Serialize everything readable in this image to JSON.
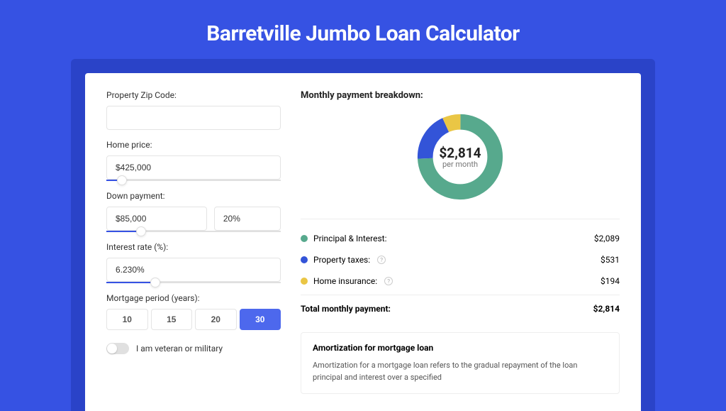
{
  "title": "Barretville Jumbo Loan Calculator",
  "form": {
    "zip": {
      "label": "Property Zip Code:",
      "value": ""
    },
    "home_price": {
      "label": "Home price:",
      "value": "$425,000",
      "slider_pct": 9
    },
    "down_payment": {
      "label": "Down payment:",
      "value": "$85,000",
      "pct_value": "20%",
      "slider_pct": 20
    },
    "interest": {
      "label": "Interest rate (%):",
      "value": "6.230%",
      "slider_pct": 28
    },
    "period": {
      "label": "Mortgage period (years):",
      "options": [
        "10",
        "15",
        "20",
        "30"
      ],
      "active": "30"
    },
    "veteran": {
      "label": "I am veteran or military",
      "on": false
    }
  },
  "breakdown": {
    "title": "Monthly payment breakdown:",
    "center_value": "$2,814",
    "center_sub": "per month",
    "rows": [
      {
        "label": "Principal & Interest:",
        "value": "$2,089",
        "color": "green",
        "info": false
      },
      {
        "label": "Property taxes:",
        "value": "$531",
        "color": "blue",
        "info": true
      },
      {
        "label": "Home insurance:",
        "value": "$194",
        "color": "yellow",
        "info": true
      }
    ],
    "total": {
      "label": "Total monthly payment:",
      "value": "$2,814"
    }
  },
  "chart_data": {
    "type": "pie",
    "title": "Monthly payment breakdown",
    "series": [
      {
        "name": "Principal & Interest",
        "value": 2089,
        "color": "#57a98d"
      },
      {
        "name": "Property taxes",
        "value": 531,
        "color": "#3354d8"
      },
      {
        "name": "Home insurance",
        "value": 194,
        "color": "#eac645"
      }
    ],
    "total": 2814
  },
  "amort": {
    "title": "Amortization for mortgage loan",
    "text": "Amortization for a mortgage loan refers to the gradual repayment of the loan principal and interest over a specified"
  }
}
